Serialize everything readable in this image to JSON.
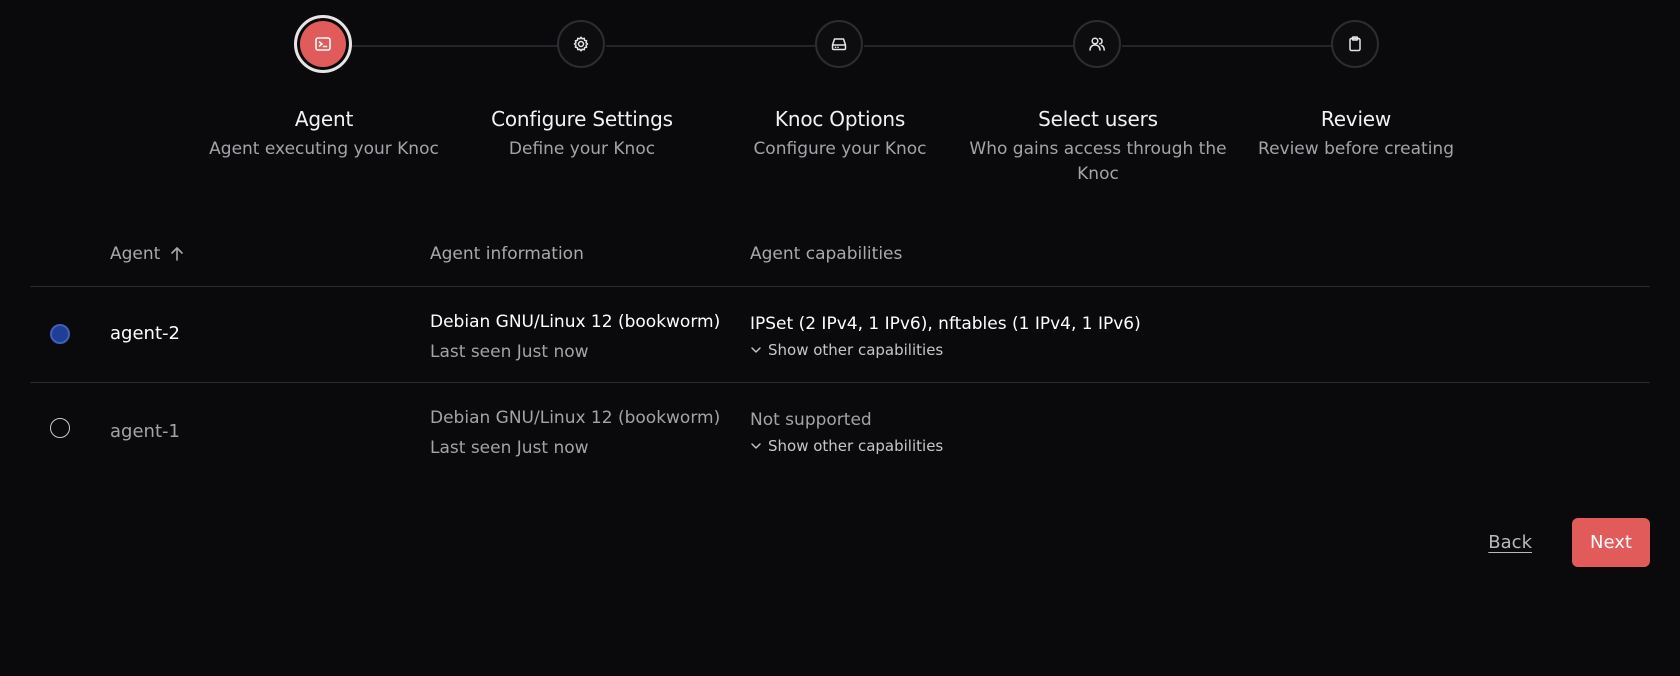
{
  "stepper": {
    "steps": [
      {
        "title": "Agent",
        "subtitle": "Agent executing your Knoc",
        "icon": "terminal-icon",
        "active": true
      },
      {
        "title": "Configure Settings",
        "subtitle": "Define your Knoc",
        "icon": "gear-icon",
        "active": false
      },
      {
        "title": "Knoc Options",
        "subtitle": "Configure your Knoc",
        "icon": "hard-drive-icon",
        "active": false
      },
      {
        "title": "Select users",
        "subtitle": "Who gains access through the Knoc",
        "icon": "users-icon",
        "active": false
      },
      {
        "title": "Review",
        "subtitle": "Review before creating",
        "icon": "clipboard-icon",
        "active": false
      }
    ]
  },
  "table": {
    "headers": {
      "agent": "Agent",
      "info": "Agent information",
      "capabilities": "Agent capabilities"
    },
    "rows": [
      {
        "name": "agent-2",
        "os": "Debian GNU/Linux 12 (bookworm)",
        "seen": "Last seen Just now",
        "capabilities": "IPSet (2 IPv4, 1 IPv6), nftables (1 IPv4, 1 IPv6)",
        "show_more": "Show other capabilities",
        "selected": true
      },
      {
        "name": "agent-1",
        "os": "Debian GNU/Linux 12 (bookworm)",
        "seen": "Last seen Just now",
        "capabilities": "Not supported",
        "show_more": "Show other capabilities",
        "selected": false
      }
    ]
  },
  "footer": {
    "back_label": "Back",
    "next_label": "Next"
  },
  "colors": {
    "accent": "#e25b5b",
    "radio_selected": "#1f3e95",
    "background": "#0a0a0c"
  }
}
